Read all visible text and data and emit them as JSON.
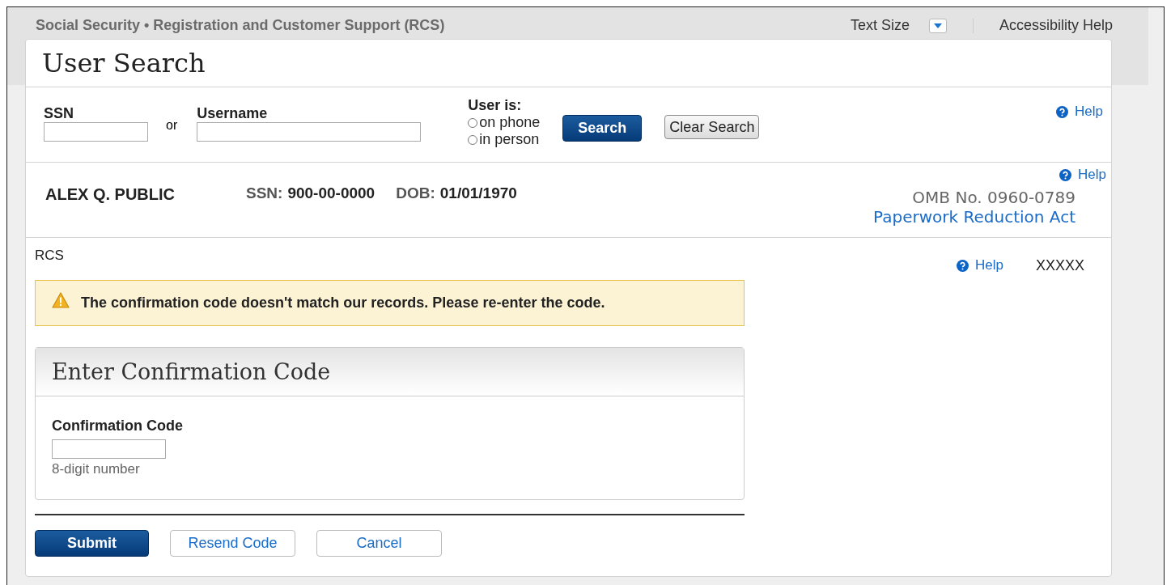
{
  "header": {
    "title": "Social Security • Registration and Customer Support (RCS)",
    "text_size": "Text Size",
    "accessibility_help": "Accessibility Help"
  },
  "page_title": "User Search",
  "search": {
    "ssn_label": "SSN",
    "or": "or",
    "username_label": "Username",
    "user_is_label": "User is:",
    "options": [
      {
        "label": "on phone",
        "selected": false
      },
      {
        "label": "in person",
        "selected": false
      }
    ],
    "buttons": [
      {
        "label": "Search",
        "kind": "primary"
      },
      {
        "label": "Clear Search",
        "kind": "plain"
      }
    ],
    "help": "Help"
  },
  "user": {
    "name": "ALEX Q. PUBLIC",
    "ssn_label": "SSN:",
    "ssn": "900-00-0000",
    "dob_label": "DOB:",
    "dob": "01/01/1970",
    "help": "Help",
    "omb": "OMB No. 0960-0789",
    "paperwork_link": "Paperwork Reduction Act"
  },
  "section": {
    "breadcrumb": "RCS",
    "help": "Help",
    "code": "XXXXX"
  },
  "alert": {
    "message": "The confirmation code doesn't match our records. Please re-enter the code."
  },
  "form": {
    "title": "Enter Confirmation Code",
    "field_label": "Confirmation Code",
    "hint": "8-digit number"
  },
  "actions": [
    {
      "label": "Submit",
      "kind": "primary"
    },
    {
      "label": "Resend Code",
      "kind": "outline"
    },
    {
      "label": "Cancel",
      "kind": "outline"
    }
  ]
}
